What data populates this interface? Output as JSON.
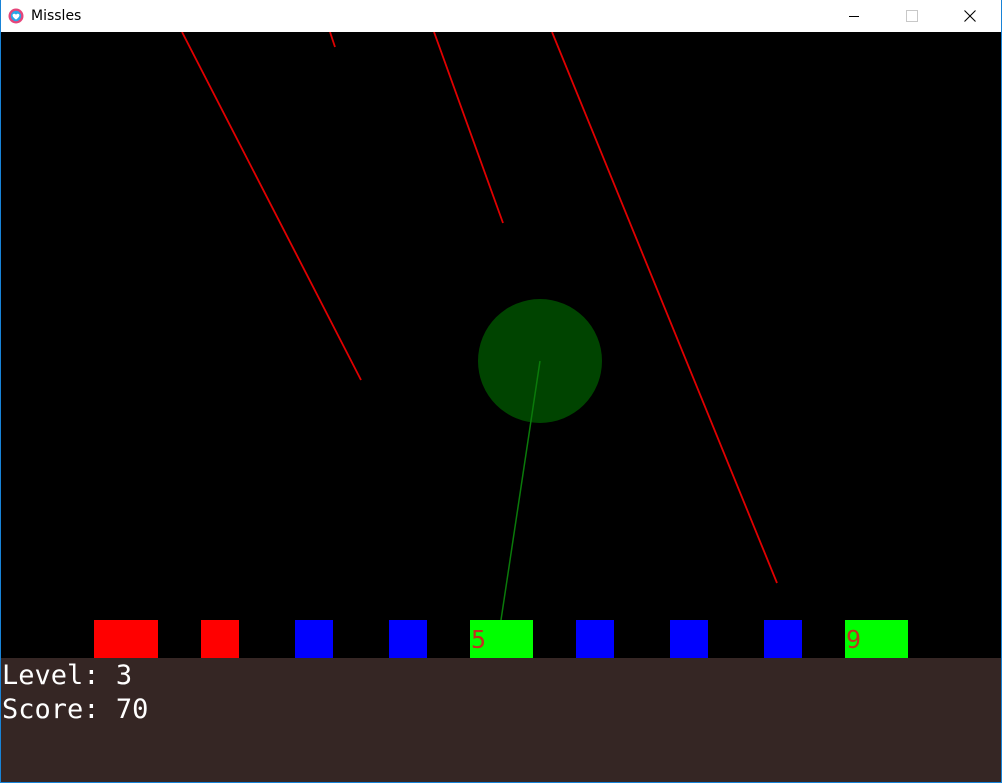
{
  "window": {
    "title": "Missles",
    "controls": {
      "minimize": "minimize-icon",
      "maximize": "maximize-icon",
      "close": "close-icon"
    }
  },
  "game": {
    "colors": {
      "background": "#000000",
      "hud_background": "#352624",
      "missile": "#e00000",
      "interceptor_trail": "#0a7a0a",
      "explosion": "#004400",
      "city_red": "#ff0000",
      "city_blue": "#0000ff",
      "city_green": "#00ff00",
      "city_label": "#c03020"
    },
    "cities": [
      {
        "color": "red",
        "label": ""
      },
      {
        "color": "red",
        "label": ""
      },
      {
        "color": "blue",
        "label": ""
      },
      {
        "color": "blue",
        "label": ""
      },
      {
        "color": "green",
        "label": "5"
      },
      {
        "color": "blue",
        "label": ""
      },
      {
        "color": "blue",
        "label": ""
      },
      {
        "color": "blue",
        "label": ""
      },
      {
        "color": "green",
        "label": "9"
      }
    ]
  },
  "hud": {
    "level_label": "Level:",
    "level": "3",
    "score_label": "Score:",
    "score": "70"
  }
}
